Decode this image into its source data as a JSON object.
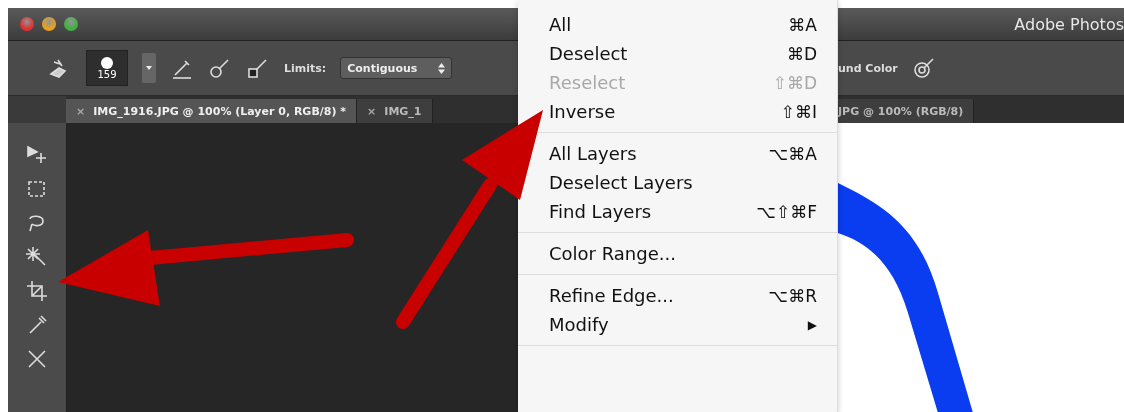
{
  "window": {
    "title": "Adobe Photos"
  },
  "options_bar": {
    "brush_size": "159",
    "limits_label": "Limits:",
    "limits_value": "Contiguous",
    "color_label": "und Color"
  },
  "tabs": [
    {
      "close": "×",
      "label": "IMG_1916.JPG @ 100% (Layer 0, RGB/8) *",
      "selected": true
    },
    {
      "close": "×",
      "label": "IMG_1",
      "selected": false
    },
    {
      "label": "JPG @ 100% (RGB/8)",
      "selected": false
    }
  ],
  "menu": {
    "groups": [
      [
        {
          "label": "All",
          "shortcut": "⌘A",
          "disabled": false
        },
        {
          "label": "Deselect",
          "shortcut": "⌘D",
          "disabled": false
        },
        {
          "label": "Reselect",
          "shortcut": "⇧⌘D",
          "disabled": true
        },
        {
          "label": "Inverse",
          "shortcut": "⇧⌘I",
          "disabled": false
        }
      ],
      [
        {
          "label": "All Layers",
          "shortcut": "⌥⌘A",
          "disabled": false
        },
        {
          "label": "Deselect Layers",
          "disabled": false
        },
        {
          "label": "Find Layers",
          "shortcut": "⌥⇧⌘F",
          "disabled": false
        }
      ],
      [
        {
          "label": "Color Range...",
          "disabled": false
        }
      ],
      [
        {
          "label": "Refine Edge...",
          "shortcut": "⌥⌘R",
          "disabled": false
        },
        {
          "label": "Modify",
          "submenu": "▶",
          "disabled": false
        }
      ]
    ]
  }
}
